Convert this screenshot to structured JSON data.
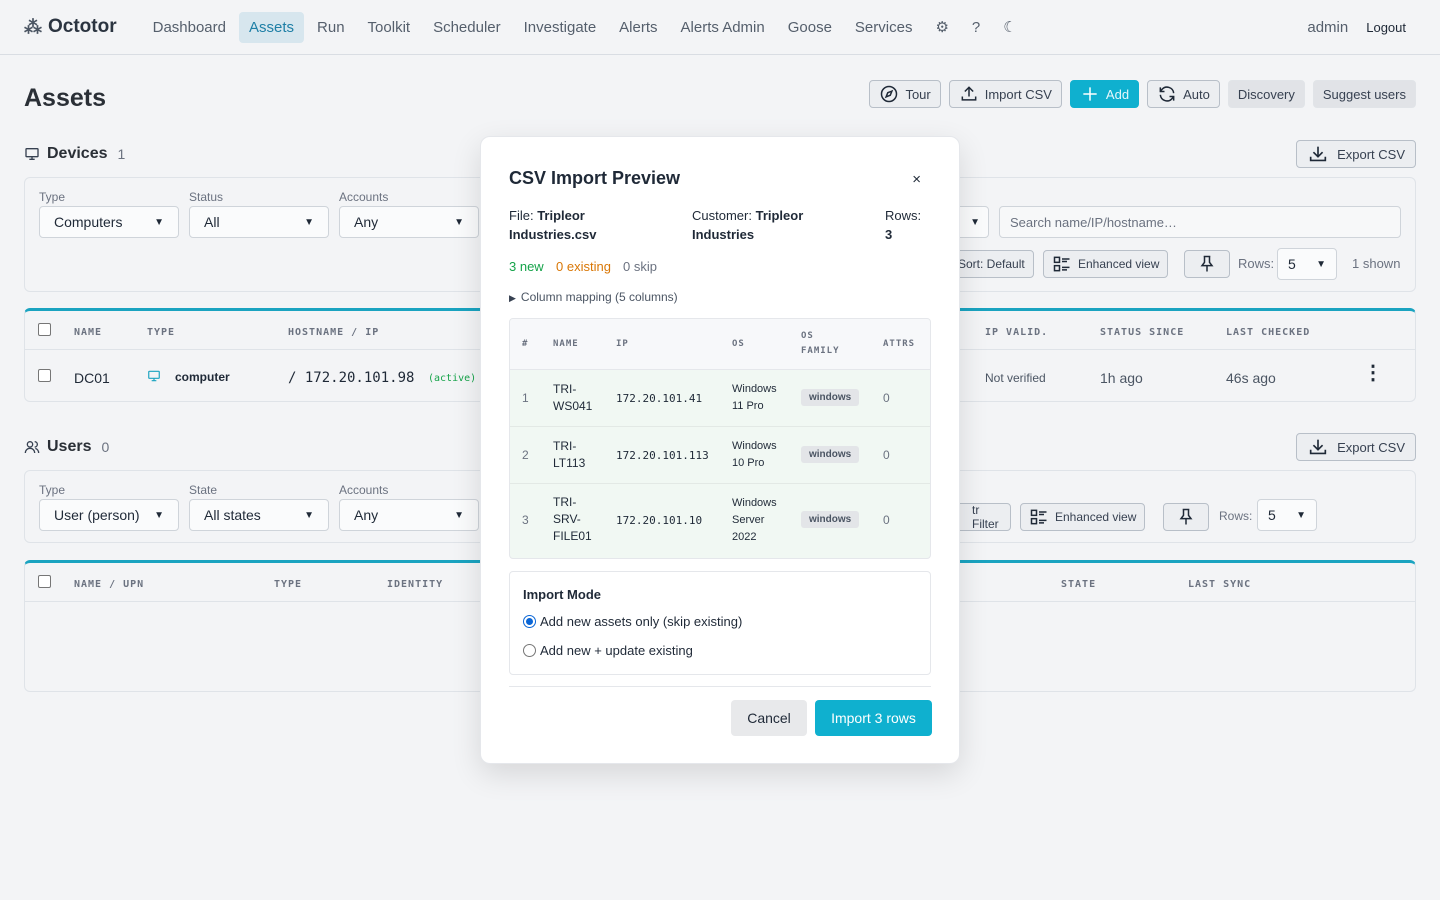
{
  "app": {
    "name": "Octotor"
  },
  "nav": {
    "items": [
      "Dashboard",
      "Assets",
      "Run",
      "Toolkit",
      "Scheduler",
      "Investigate",
      "Alerts",
      "Alerts Admin",
      "Goose",
      "Services"
    ],
    "active": "Assets",
    "settings_icon": "⚙",
    "help_label": "?",
    "theme_icon": "☾",
    "user": "admin",
    "logout": "Logout"
  },
  "page": {
    "title": "Assets"
  },
  "toolbar": {
    "tour": "Tour",
    "import_csv": "Import CSV",
    "add": "Add",
    "auto": "Auto",
    "discovery": "Discovery",
    "suggest_users": "Suggest users"
  },
  "devices": {
    "title": "Devices",
    "count": "1",
    "export": "Export CSV",
    "filters": {
      "type_label": "Type",
      "type_value": "Computers",
      "status_label": "Status",
      "status_value": "All",
      "accounts_label": "Accounts",
      "accounts_value": "Any",
      "search_placeholder": "Search name/IP/hostname…",
      "sort": "Sort: Default",
      "enhanced_view": "Enhanced view",
      "rows_label": "Rows:",
      "rows_value": "5",
      "shown": "1 shown"
    },
    "columns": [
      "NAME",
      "TYPE",
      "HOSTNAME / IP",
      "IP VALID.",
      "STATUS SINCE",
      "LAST CHECKED"
    ],
    "rows": [
      {
        "name": "DC01",
        "type": "computer",
        "host": "/ 172.20.101.98",
        "state": "(active)",
        "ip_valid": "Not verified",
        "status_since": "1h ago",
        "last_checked": "46s ago"
      }
    ]
  },
  "users": {
    "title": "Users",
    "count": "0",
    "export": "Export CSV",
    "filters": {
      "type_label": "Type",
      "type_value": "User (person)",
      "state_label": "State",
      "state_value": "All states",
      "accounts_label": "Accounts",
      "accounts_value": "Any",
      "filter_btn": "tr Filter",
      "enhanced_view": "Enhanced view",
      "rows_label": "Rows:",
      "rows_value": "5"
    },
    "columns": [
      "NAME / UPN",
      "TYPE",
      "IDENTITY",
      "STATE",
      "LAST SYNC"
    ]
  },
  "modal": {
    "title": "CSV Import Preview",
    "close": "×",
    "file_label": "File:",
    "file_name_1": "Tripleor",
    "file_name_2": "Industries.csv",
    "customer_label": "Customer:",
    "customer_1": "Tripleor",
    "customer_2": "Industries",
    "rows_label": "Rows:",
    "rows_value": "3",
    "stat_new": "3 new",
    "stat_existing": "0 existing",
    "stat_skip": "0 skip",
    "mapping": "Column mapping (5 columns)",
    "columns": [
      "#",
      "NAME",
      "IP",
      "OS",
      "OS",
      "FAMILY",
      "ATTRS"
    ],
    "rows": [
      {
        "n": "1",
        "name_1": "TRI-",
        "name_2": "WS041",
        "name_3": "",
        "ip": "172.20.101.41",
        "os_1": "Windows",
        "os_2": "11 Pro",
        "os_3": "",
        "family": "windows",
        "attrs": "0"
      },
      {
        "n": "2",
        "name_1": "TRI-",
        "name_2": "LT113",
        "name_3": "",
        "ip": "172.20.101.113",
        "os_1": "Windows",
        "os_2": "10 Pro",
        "os_3": "",
        "family": "windows",
        "attrs": "0"
      },
      {
        "n": "3",
        "name_1": "TRI-",
        "name_2": "SRV-",
        "name_3": "FILE01",
        "ip": "172.20.101.10",
        "os_1": "Windows",
        "os_2": "Server",
        "os_3": "2022",
        "family": "windows",
        "attrs": "0"
      }
    ],
    "mode_title": "Import Mode",
    "mode_option_1": "Add new assets only (skip existing)",
    "mode_option_2": "Add new + update existing",
    "cancel": "Cancel",
    "import": "Import 3 rows"
  },
  "colors": {
    "accent": "#0fb0cf",
    "new": "#16a34a",
    "existing": "#d97706"
  }
}
